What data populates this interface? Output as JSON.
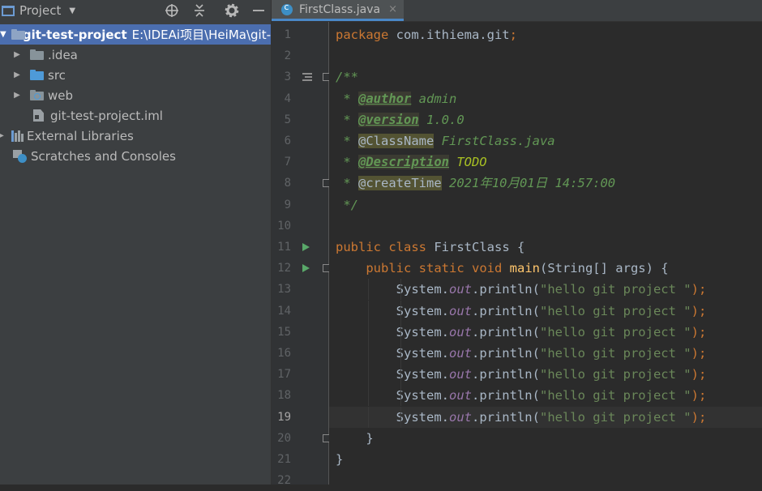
{
  "project_panel": {
    "title": "Project",
    "tools": [
      "locate-icon",
      "collapse-icon",
      "gear-icon",
      "minimize-icon"
    ],
    "tree": [
      {
        "label": "git-test-project",
        "path": "E:\\IDEAi项目\\HeiMa\\git-",
        "depth": 0,
        "expanded": true,
        "selected": true,
        "icon": "project-folder-icon"
      },
      {
        "label": ".idea",
        "depth": 1,
        "expanded": false,
        "icon": "folder-icon"
      },
      {
        "label": "src",
        "depth": 1,
        "expanded": false,
        "icon": "source-folder-icon"
      },
      {
        "label": "web",
        "depth": 1,
        "expanded": false,
        "icon": "web-folder-icon"
      },
      {
        "label": "git-test-project.iml",
        "depth": 1,
        "icon": "module-file-icon"
      },
      {
        "label": "External Libraries",
        "depth": 0,
        "expanded": false,
        "icon": "libraries-icon"
      },
      {
        "label": "Scratches and Consoles",
        "depth": 0,
        "icon": "scratches-icon"
      }
    ]
  },
  "editor": {
    "tab": {
      "label": "FirstClass.java",
      "close": "×"
    },
    "current_line": 19,
    "lines": [
      [
        {
          "t": "package ",
          "c": "kw"
        },
        {
          "t": "com.ithiema.git",
          "c": "plain"
        },
        {
          "t": ";",
          "c": "kw"
        }
      ],
      [],
      [
        {
          "t": "/**",
          "c": "doc"
        }
      ],
      [
        {
          "t": " * ",
          "c": "doc"
        },
        {
          "t": "@author",
          "c": "tag"
        },
        {
          "t": " admin",
          "c": "doc"
        }
      ],
      [
        {
          "t": " * ",
          "c": "doc"
        },
        {
          "t": "@version",
          "c": "tag"
        },
        {
          "t": " 1.0.0",
          "c": "doc"
        }
      ],
      [
        {
          "t": " * ",
          "c": "doc"
        },
        {
          "t": "@ClassName",
          "c": "tag-hl"
        },
        {
          "t": " FirstClass.java",
          "c": "doc"
        }
      ],
      [
        {
          "t": " * ",
          "c": "doc"
        },
        {
          "t": "@Description",
          "c": "tag"
        },
        {
          "t": " TODO",
          "c": "todo"
        }
      ],
      [
        {
          "t": " * ",
          "c": "doc"
        },
        {
          "t": "@createTime",
          "c": "tag-hl"
        },
        {
          "t": " 2021年10月01日 14:57:00",
          "c": "doc"
        }
      ],
      [
        {
          "t": " */",
          "c": "doc"
        }
      ],
      [],
      [
        {
          "t": "public ",
          "c": "kw"
        },
        {
          "t": "class ",
          "c": "kw"
        },
        {
          "t": "FirstClass {",
          "c": "plain"
        }
      ],
      [
        {
          "t": "    public ",
          "c": "kw"
        },
        {
          "t": "static ",
          "c": "kw"
        },
        {
          "t": "void ",
          "c": "kw"
        },
        {
          "t": "main",
          "c": "method-def"
        },
        {
          "t": "(String[] args) {",
          "c": "plain"
        }
      ],
      [
        {
          "t": "        System.",
          "c": "plain"
        },
        {
          "t": "out",
          "c": "static-field"
        },
        {
          "t": ".println(",
          "c": "plain"
        },
        {
          "t": "\"hello git project \"",
          "c": "str"
        },
        {
          "t": ");",
          "c": "kw"
        }
      ],
      [
        {
          "t": "        System.",
          "c": "plain"
        },
        {
          "t": "out",
          "c": "static-field"
        },
        {
          "t": ".println(",
          "c": "plain"
        },
        {
          "t": "\"hello git project \"",
          "c": "str"
        },
        {
          "t": ");",
          "c": "kw"
        }
      ],
      [
        {
          "t": "        System.",
          "c": "plain"
        },
        {
          "t": "out",
          "c": "static-field"
        },
        {
          "t": ".println(",
          "c": "plain"
        },
        {
          "t": "\"hello git project \"",
          "c": "str"
        },
        {
          "t": ");",
          "c": "kw"
        }
      ],
      [
        {
          "t": "        System.",
          "c": "plain"
        },
        {
          "t": "out",
          "c": "static-field"
        },
        {
          "t": ".println(",
          "c": "plain"
        },
        {
          "t": "\"hello git project \"",
          "c": "str"
        },
        {
          "t": ");",
          "c": "kw"
        }
      ],
      [
        {
          "t": "        System.",
          "c": "plain"
        },
        {
          "t": "out",
          "c": "static-field"
        },
        {
          "t": ".println(",
          "c": "plain"
        },
        {
          "t": "\"hello git project \"",
          "c": "str"
        },
        {
          "t": ");",
          "c": "kw"
        }
      ],
      [
        {
          "t": "        System.",
          "c": "plain"
        },
        {
          "t": "out",
          "c": "static-field"
        },
        {
          "t": ".println(",
          "c": "plain"
        },
        {
          "t": "\"hello git project \"",
          "c": "str"
        },
        {
          "t": ");",
          "c": "kw"
        }
      ],
      [
        {
          "t": "        System.",
          "c": "plain"
        },
        {
          "t": "out",
          "c": "static-field"
        },
        {
          "t": ".println(",
          "c": "plain"
        },
        {
          "t": "\"hello git project \"",
          "c": "str"
        },
        {
          "t": ");",
          "c": "kw"
        }
      ],
      [
        {
          "t": "    }",
          "c": "plain"
        }
      ],
      [
        {
          "t": "}",
          "c": "plain"
        }
      ],
      []
    ],
    "gutter_markers": {
      "3": "implemented-icon",
      "11": "run-icon",
      "12": "run-icon"
    },
    "fold_markers": [
      3,
      8,
      12,
      20
    ]
  }
}
